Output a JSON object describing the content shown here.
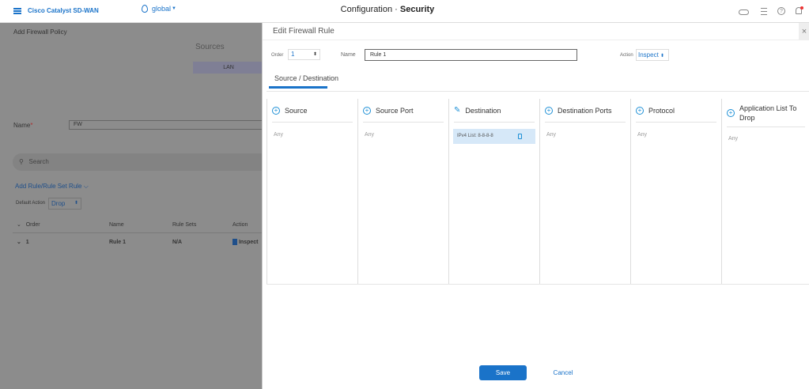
{
  "header": {
    "brand": "Cisco Catalyst SD-WAN",
    "location": "global",
    "title_prefix": "Configuration · ",
    "title_bold": "Security"
  },
  "background": {
    "page_title": "Add Firewall Policy",
    "sources_label": "Sources",
    "lan_tab": "LAN",
    "name_label": "Name",
    "name_value": "FW",
    "search_placeholder": "Search",
    "add_rule": "Add Rule/Rule Set Rule",
    "default_action_label": "Default Action",
    "default_action_value": "Drop",
    "table": {
      "headers": [
        "Order",
        "Name",
        "Rule Sets",
        "Action"
      ],
      "rows": [
        {
          "order": "1",
          "name": "Rule 1",
          "rule_sets": "N/A",
          "action": "Inspect"
        }
      ]
    }
  },
  "drawer": {
    "title": "Edit Firewall Rule",
    "order_label": "Order",
    "order_value": "1",
    "name_label": "Name",
    "name_value": "Rule 1",
    "action_label": "Action",
    "action_value": "Inspect",
    "tab": "Source / Destination",
    "columns": [
      {
        "label": "Source",
        "icon": "plus",
        "value": "Any"
      },
      {
        "label": "Source Port",
        "icon": "plus",
        "value": "Any"
      },
      {
        "label": "Destination",
        "icon": "pencil",
        "chip": "IPv4 List: 8-8-8-8"
      },
      {
        "label": "Destination Ports",
        "icon": "plus",
        "value": "Any"
      },
      {
        "label": "Protocol",
        "icon": "plus",
        "value": "Any"
      },
      {
        "label": "Application List To Drop",
        "icon": "plus",
        "value": "Any"
      }
    ],
    "save": "Save",
    "cancel": "Cancel"
  },
  "colors": {
    "accent": "#1a73c9",
    "overlay": "#8c8c8c"
  }
}
